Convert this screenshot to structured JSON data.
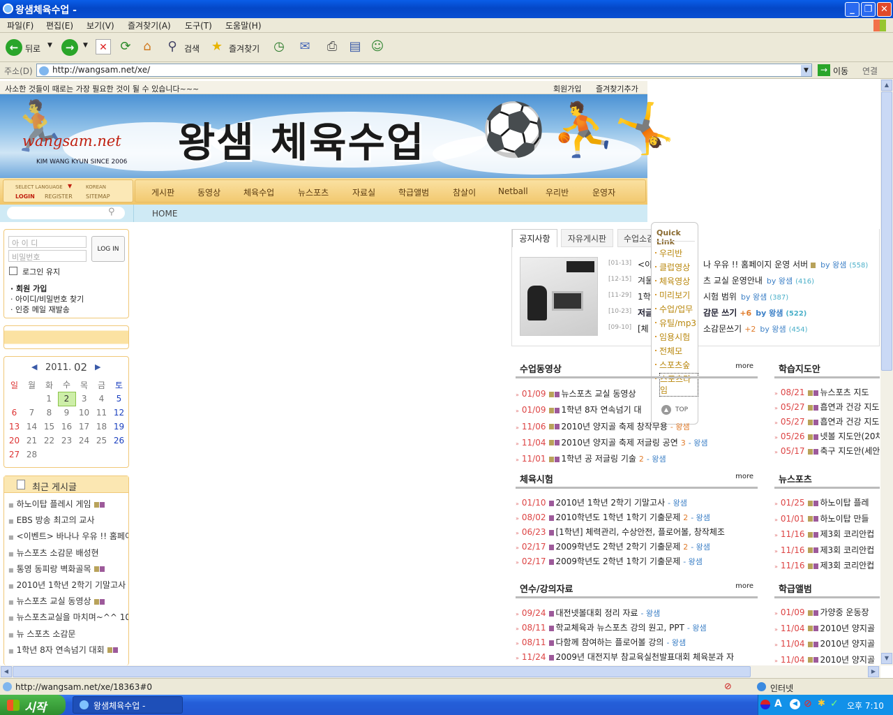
{
  "window": {
    "title": "왕샘체육수업 -"
  },
  "menu": [
    "파일(F)",
    "편집(E)",
    "보기(V)",
    "즐겨찾기(A)",
    "도구(T)",
    "도움말(H)"
  ],
  "toolbar": {
    "back": "뒤로",
    "search": "검색",
    "favorites": "즐겨찾기"
  },
  "address": {
    "label": "주소(D)",
    "url": "http://wangsam.net/xe/",
    "go": "이동",
    "links": "연결"
  },
  "site": {
    "tagline": "사소한 것들이 때로는 가장 필요한 것이 될 수 있습니다~~~",
    "top_links": [
      "회원가입",
      "즐겨찾기추가"
    ],
    "title": "왕샘 체육수업",
    "logo": "wangsam.net",
    "logo_sub": "KIM WANG KYUN SINCE 2006",
    "util": {
      "select_language": "SELECT LANGUAGE",
      "korean": "KOREAN",
      "login": "LOGIN",
      "register": "REGISTER",
      "sitemap": "SITEMAP"
    },
    "nav": [
      "게시판",
      "동영상",
      "체육수업",
      "뉴스포츠",
      "자료실",
      "학급앨범",
      "참살이",
      "Netball",
      "우리반",
      "운영자"
    ],
    "breadcrumb": "HOME"
  },
  "login": {
    "id_placeholder": "아 이 디",
    "pw_placeholder": "비밀번호",
    "button": "LOG IN",
    "keep": "로그인 유지",
    "links": [
      "회원 가입",
      "아이디/비밀번호 찾기",
      "인증 메일 재발송"
    ]
  },
  "calendar": {
    "year": "2011.",
    "month": "02",
    "weekdays": [
      "일",
      "월",
      "화",
      "수",
      "목",
      "금",
      "토"
    ],
    "weeks": [
      [
        "",
        "",
        "1",
        "2",
        "3",
        "4",
        "5"
      ],
      [
        "6",
        "7",
        "8",
        "9",
        "10",
        "11",
        "12"
      ],
      [
        "13",
        "14",
        "15",
        "16",
        "17",
        "18",
        "19"
      ],
      [
        "20",
        "21",
        "22",
        "23",
        "24",
        "25",
        "26"
      ],
      [
        "27",
        "28",
        "",
        "",
        "",
        "",
        ""
      ]
    ],
    "today": "2"
  },
  "recent": {
    "title": "최근 게시글",
    "items": [
      "하노이탑 플레시 게임",
      "EBS 방송 최고의 교사",
      "<이벤트> 바나나 우유 !! 홈페이",
      "뉴스포츠 소감문 배성현",
      "통영 동피랑 벽화골목",
      "2010년 1학년 2학기 기말고사 (",
      "뉴스포츠 교실 동영상",
      "뉴스포츠교실을 마치며~^^ 10",
      "뉴 스포츠 소감문",
      "1학년 8자 연속넘기 대회"
    ]
  },
  "notice": {
    "tabs": [
      "공지사항",
      "자유게시판",
      "수업소감"
    ],
    "rows": [
      {
        "date": "[01-13]",
        "title": "<이",
        "tail": "나 우유 !! 홈페이지 운영 서버",
        "by": "by 왕샘",
        "count": "(558)"
      },
      {
        "date": "[12-15]",
        "title": "겨울",
        "tail": "츠 교실 운영안내",
        "by": "by 왕샘",
        "count": "(416)"
      },
      {
        "date": "[11-29]",
        "title": "1학",
        "tail": "시험 범위",
        "by": "by 왕샘",
        "count": "(387)"
      },
      {
        "date": "[10-23]",
        "title": "저글",
        "tail": "감문 쓰기",
        "num": "+6",
        "by": "by 왕샘",
        "count": "(522)"
      },
      {
        "date": "[09-10]",
        "title": "[체",
        "tail": "소감문쓰기",
        "num": "+2",
        "by": "by 왕샘",
        "count": "(454)"
      }
    ]
  },
  "quick": {
    "title": "Quick Link",
    "items": [
      "우리반",
      "클럽영상",
      "체육영상",
      "미리보기",
      "수업/업무",
      "유틸/mp3",
      "임용시험",
      "전체모",
      "스포츠숲",
      "스포츠타임"
    ],
    "top": "TOP"
  },
  "more": "more",
  "sections": {
    "video": {
      "title": "수업동영상",
      "rows": [
        [
          "01/09",
          "뉴스포츠 교실 동영상",
          ""
        ],
        [
          "01/09",
          "1학년 8자 연속넘기 대",
          ""
        ],
        [
          "11/06",
          "2010년 양지골 축제 창작무용",
          "- 왕샘"
        ],
        [
          "11/04",
          "2010년 양지골 축제 저글링 공연",
          "3",
          "- 왕샘"
        ],
        [
          "11/01",
          "1학년 공 저글링 기술",
          "2",
          "- 왕샘"
        ]
      ]
    },
    "exam": {
      "title": "체육시험",
      "rows": [
        [
          "01/10",
          "2010년 1학년 2학기 기말고사",
          "",
          "- 왕샘"
        ],
        [
          "08/02",
          "2010학년도 1학년 1학기 기출문제",
          "2",
          "- 왕샘"
        ],
        [
          "06/23",
          "[1학년] 체력관리, 수상안전, 플로어볼, 창작체조",
          "",
          ""
        ],
        [
          "02/17",
          "2009학년도 2학년 2학기 기출문제",
          "2",
          "- 왕샘"
        ],
        [
          "02/17",
          "2009학년도 2학년 1학기 기출문제",
          "",
          "- 왕샘"
        ]
      ]
    },
    "lecture": {
      "title": "연수/강의자료",
      "rows": [
        [
          "09/24",
          "대전넷볼대회 정리 자료",
          "",
          "- 왕샘"
        ],
        [
          "08/11",
          "학교체육과 뉴스포츠 강의 원고, PPT",
          "",
          "- 왕샘"
        ],
        [
          "08/11",
          "다함께 참여하는 플로어볼 강의",
          "",
          "- 왕샘"
        ],
        [
          "11/24",
          "2009년 대전지부 참교육실천발표대회 체육분과 자",
          "",
          ""
        ]
      ]
    },
    "guide": {
      "title": "학습지도안",
      "rows": [
        [
          "08/21",
          "뉴스포츠 지도"
        ],
        [
          "05/27",
          "흡연과 건강 지도"
        ],
        [
          "05/27",
          "흡연과 건강 지도"
        ],
        [
          "05/26",
          "넷볼 지도안(20차"
        ],
        [
          "05/17",
          "축구 지도안(세안"
        ]
      ]
    },
    "news": {
      "title": "뉴스포츠",
      "rows": [
        [
          "01/25",
          "하노이탑 플레"
        ],
        [
          "01/01",
          "하노이탑 만들"
        ],
        [
          "11/16",
          "제3회 코리안컵"
        ],
        [
          "11/16",
          "제3회 코리안컵"
        ],
        [
          "11/16",
          "제3회 코리안컵"
        ]
      ]
    },
    "album": {
      "title": "학급앨범",
      "rows": [
        [
          "01/09",
          "가양중 운동장"
        ],
        [
          "11/04",
          "2010년 양지골"
        ],
        [
          "11/04",
          "2010년 양지골"
        ],
        [
          "11/04",
          "2010년 양지골"
        ]
      ]
    }
  },
  "status": {
    "url": "http://wangsam.net/xe/18363#0",
    "zone": "인터넷"
  },
  "taskbar": {
    "start": "시작",
    "task": "왕샘체육수업 -",
    "clock": "오후 7:10"
  }
}
